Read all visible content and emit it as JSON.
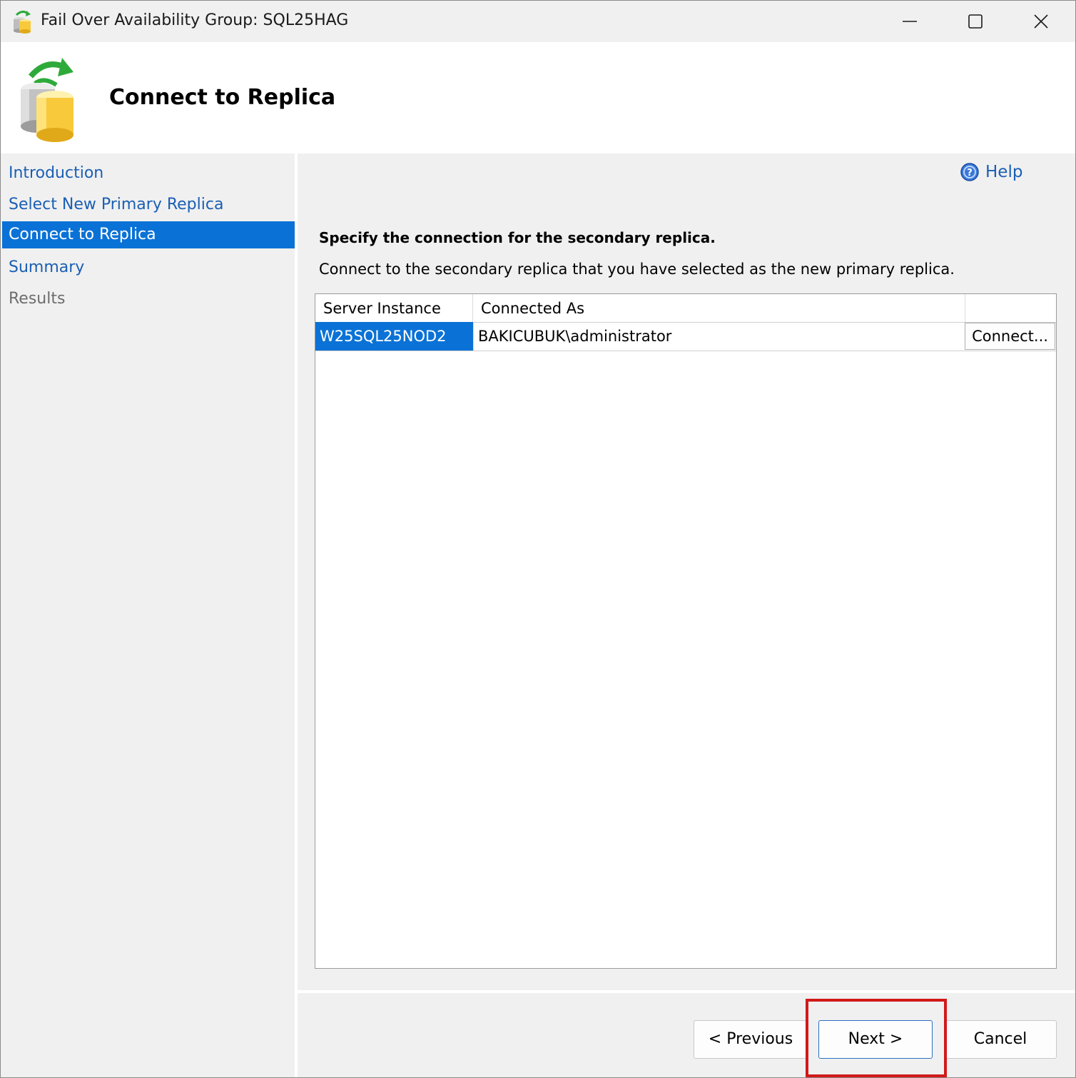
{
  "window": {
    "title": "Fail Over Availability Group: SQL25HAG"
  },
  "header": {
    "title": "Connect to Replica"
  },
  "nav": {
    "items": [
      {
        "label": "Introduction",
        "state": "link"
      },
      {
        "label": "Select New Primary Replica",
        "state": "link"
      },
      {
        "label": "Connect to Replica",
        "state": "selected"
      },
      {
        "label": "Summary",
        "state": "link"
      },
      {
        "label": "Results",
        "state": "disabled"
      }
    ]
  },
  "help": {
    "label": "Help"
  },
  "main": {
    "heading": "Specify the connection for the secondary replica.",
    "description": "Connect to the secondary replica that you have selected as the new primary replica."
  },
  "grid": {
    "columns": [
      "Server Instance",
      "Connected As",
      ""
    ],
    "rows": [
      {
        "server_instance": "W25SQL25NOD2",
        "connected_as": "BAKICUBUK\\administrator",
        "action": "Connect..."
      }
    ]
  },
  "buttons": {
    "previous": "< Previous",
    "next": "Next >",
    "cancel": "Cancel"
  },
  "colors": {
    "selection": "#0a72d6",
    "link": "#1a5fb4",
    "highlight_box": "#d11a1a"
  }
}
